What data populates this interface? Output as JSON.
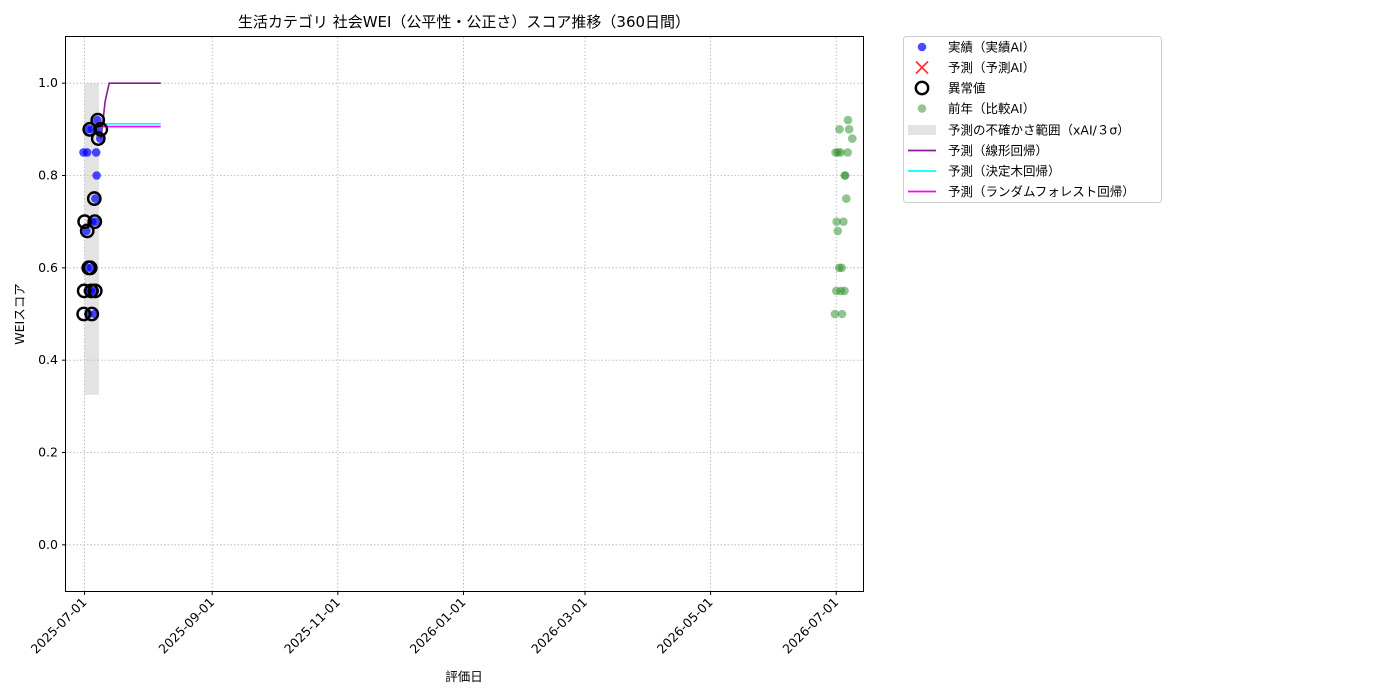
{
  "chart_data": {
    "type": "scatter",
    "title": "生活カテゴリ 社会WEI（公平性・公正さ）スコア推移（360日間）",
    "xlabel": "評価日",
    "ylabel": "WEIスコア",
    "ylim": [
      -0.1,
      1.1
    ],
    "xlim": [
      "2025-06-22",
      "2026-07-14"
    ],
    "yticks": [
      0.0,
      0.2,
      0.4,
      0.6,
      0.8,
      1.0
    ],
    "ytick_labels": [
      "0.0",
      "0.2",
      "0.4",
      "0.6",
      "0.8",
      "1.0"
    ],
    "xticks": [
      "2025-07-01",
      "2025-09-01",
      "2025-11-01",
      "2026-01-01",
      "2026-03-01",
      "2026-05-01",
      "2026-07-01"
    ],
    "grid": true,
    "legend_position": "outside-top-right",
    "legend": [
      {
        "label": "実績（実績AI）",
        "kind": "dot",
        "color": "#0000ff"
      },
      {
        "label": "予測（予測AI）",
        "kind": "x",
        "color": "#ff0000"
      },
      {
        "label": "異常値",
        "kind": "ring",
        "color": "#000000"
      },
      {
        "label": "前年（比較AI）",
        "kind": "dot",
        "color": "#228b22"
      },
      {
        "label": "予測の不確かさ範囲（xAI/３σ）",
        "kind": "band",
        "color": "#c8c8c8"
      },
      {
        "label": "予測（線形回帰）",
        "kind": "line",
        "color": "#8b1a9b"
      },
      {
        "label": "予測（決定木回帰）",
        "kind": "line",
        "color": "#00ffff"
      },
      {
        "label": "予測（ランダムフォレスト回帰）",
        "kind": "line",
        "color": "#ff00ff"
      }
    ],
    "series": [
      {
        "name": "実績（実績AI）",
        "color": "#0000ff",
        "points": [
          {
            "x": "2025-07-01",
            "y": 0.85
          },
          {
            "x": "2025-07-02",
            "y": 0.68
          },
          {
            "x": "2025-07-02",
            "y": 0.85
          },
          {
            "x": "2025-07-02",
            "y": 0.9
          },
          {
            "x": "2025-07-03",
            "y": 0.6
          },
          {
            "x": "2025-07-03",
            "y": 0.55
          },
          {
            "x": "2025-07-03",
            "y": 0.5
          },
          {
            "x": "2025-07-04",
            "y": 0.6
          },
          {
            "x": "2025-07-04",
            "y": 0.7
          },
          {
            "x": "2025-07-05",
            "y": 0.55
          },
          {
            "x": "2025-07-05",
            "y": 0.9
          },
          {
            "x": "2025-07-06",
            "y": 0.5
          },
          {
            "x": "2025-07-06",
            "y": 0.75
          },
          {
            "x": "2025-07-06",
            "y": 0.85
          },
          {
            "x": "2025-07-07",
            "y": 0.55
          },
          {
            "x": "2025-07-07",
            "y": 0.7
          },
          {
            "x": "2025-07-07",
            "y": 0.8
          },
          {
            "x": "2025-07-07",
            "y": 0.92
          },
          {
            "x": "2025-07-08",
            "y": 0.88
          },
          {
            "x": "2025-07-08",
            "y": 0.9
          }
        ]
      },
      {
        "name": "異常値",
        "color": "#000000",
        "points": [
          {
            "x": "2025-07-01",
            "y": 0.5
          },
          {
            "x": "2025-07-01",
            "y": 0.55
          },
          {
            "x": "2025-07-01",
            "y": 0.7
          },
          {
            "x": "2025-07-02",
            "y": 0.68
          },
          {
            "x": "2025-07-03",
            "y": 0.9
          },
          {
            "x": "2025-07-03",
            "y": 0.6
          },
          {
            "x": "2025-07-04",
            "y": 0.6
          },
          {
            "x": "2025-07-05",
            "y": 0.55
          },
          {
            "x": "2025-07-05",
            "y": 0.5
          },
          {
            "x": "2025-07-06",
            "y": 0.75
          },
          {
            "x": "2025-07-06",
            "y": 0.7
          },
          {
            "x": "2025-07-06",
            "y": 0.55
          },
          {
            "x": "2025-07-07",
            "y": 0.92
          },
          {
            "x": "2025-07-07",
            "y": 0.88
          },
          {
            "x": "2025-07-08",
            "y": 0.9
          }
        ]
      },
      {
        "name": "前年（比較AI）",
        "color": "#228b22",
        "points": [
          {
            "x": "2026-07-01",
            "y": 0.85
          },
          {
            "x": "2026-07-01",
            "y": 0.7
          },
          {
            "x": "2026-07-01",
            "y": 0.68
          },
          {
            "x": "2026-07-01",
            "y": 0.5
          },
          {
            "x": "2026-07-02",
            "y": 0.85
          },
          {
            "x": "2026-07-02",
            "y": 0.6
          },
          {
            "x": "2026-07-02",
            "y": 0.55
          },
          {
            "x": "2026-07-03",
            "y": 0.9
          },
          {
            "x": "2026-07-03",
            "y": 0.85
          },
          {
            "x": "2026-07-03",
            "y": 0.6
          },
          {
            "x": "2026-07-04",
            "y": 0.55
          },
          {
            "x": "2026-07-04",
            "y": 0.5
          },
          {
            "x": "2026-07-05",
            "y": 0.8
          },
          {
            "x": "2026-07-05",
            "y": 0.75
          },
          {
            "x": "2026-07-05",
            "y": 0.7
          },
          {
            "x": "2026-07-05",
            "y": 0.55
          },
          {
            "x": "2026-07-06",
            "y": 0.85
          },
          {
            "x": "2026-07-06",
            "y": 0.8
          },
          {
            "x": "2026-07-07",
            "y": 0.92
          },
          {
            "x": "2026-07-07",
            "y": 0.9
          },
          {
            "x": "2026-07-08",
            "y": 0.88
          }
        ]
      },
      {
        "name": "予測（線形回帰）",
        "color": "#8b1a9b",
        "points": [
          {
            "x": "2025-07-09",
            "y": 0.88
          },
          {
            "x": "2025-07-11",
            "y": 0.96
          },
          {
            "x": "2025-07-13",
            "y": 1.0
          },
          {
            "x": "2025-08-07",
            "y": 1.0
          }
        ]
      },
      {
        "name": "予測（決定木回帰）",
        "color": "#00ffff",
        "points": [
          {
            "x": "2025-07-09",
            "y": 0.912
          },
          {
            "x": "2025-08-07",
            "y": 0.912
          }
        ]
      },
      {
        "name": "予測（ランダムフォレスト回帰）",
        "color": "#ff00ff",
        "points": [
          {
            "x": "2025-07-09",
            "y": 0.906
          },
          {
            "x": "2025-08-07",
            "y": 0.906
          }
        ]
      }
    ],
    "band": {
      "name": "予測の不確かさ範囲（xAI/３σ）",
      "x": [
        "2025-07-01",
        "2025-07-08"
      ],
      "y_low": 0.325,
      "y_high": 1.0
    }
  }
}
